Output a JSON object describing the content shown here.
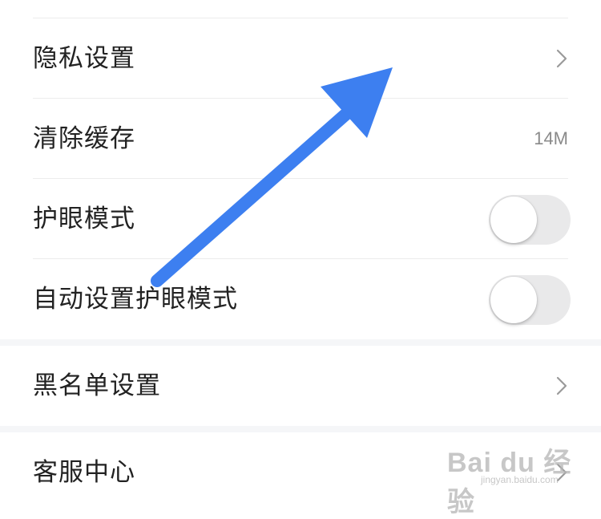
{
  "settings": {
    "privacy_label": "隐私设置",
    "clear_cache_label": "清除缓存",
    "cache_size": "14M",
    "eye_care_label": "护眼模式",
    "eye_care_on": false,
    "auto_eye_care_label": "自动设置护眼模式",
    "auto_eye_care_on": false,
    "blacklist_label": "黑名单设置",
    "service_label": "客服中心"
  },
  "icons": {
    "chevron": "chevron-right-icon",
    "annotation": "blue-arrow-icon"
  },
  "colors": {
    "annotation_arrow": "#3d7ff0",
    "toggle_off": "#e9e9ea",
    "text": "#222222",
    "secondary_text": "#8a8a8a"
  },
  "watermark": {
    "logo": "Bai du 经验",
    "url": "jingyan.baidu.com"
  }
}
